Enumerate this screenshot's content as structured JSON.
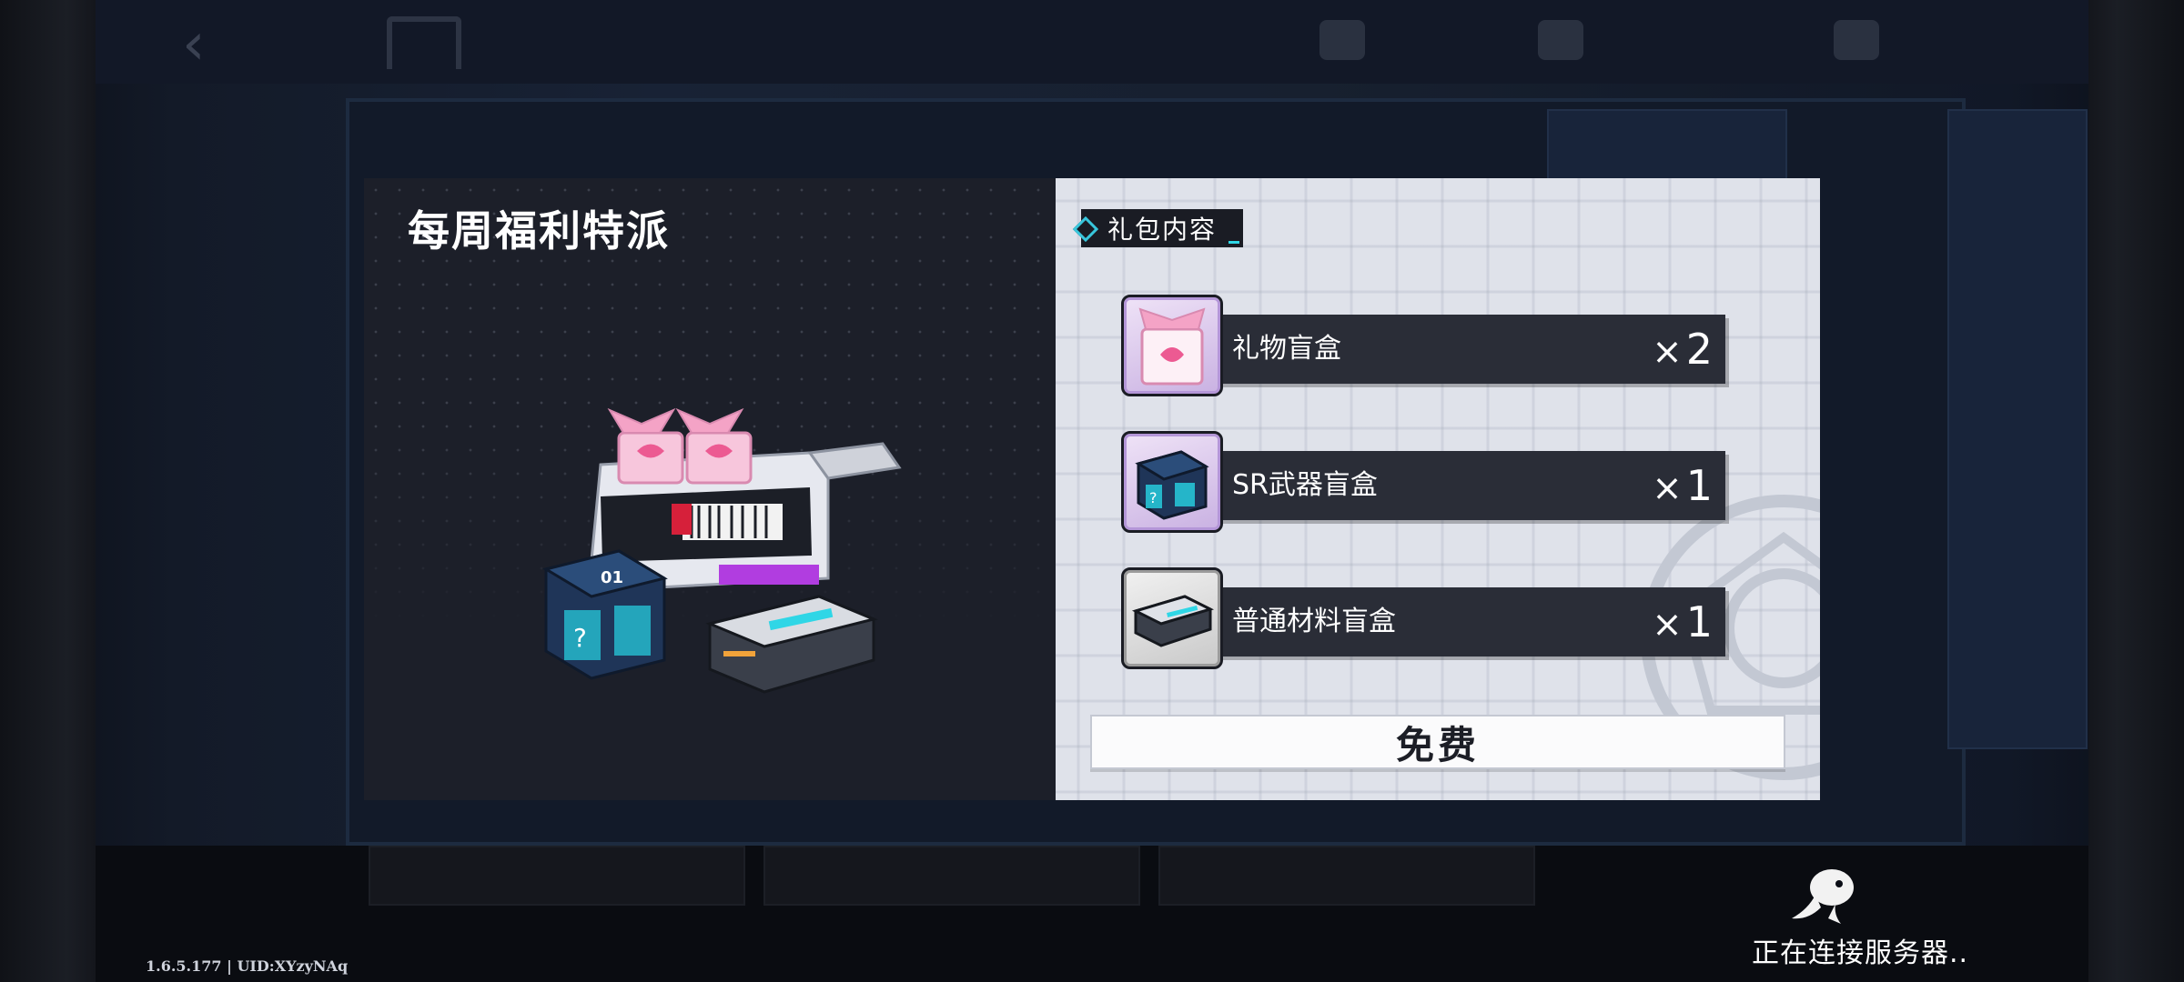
{
  "dialog": {
    "title": "每周福利特派",
    "section_label": "礼包内容",
    "items": [
      {
        "name": "礼物盲盒",
        "qty_prefix": "×",
        "qty": "2",
        "icon": "gift-bag-icon"
      },
      {
        "name": "SR武器盲盒",
        "qty_prefix": "×",
        "qty": "1",
        "icon": "weapon-box-icon"
      },
      {
        "name": "普通材料盲盒",
        "qty_prefix": "×",
        "qty": "1",
        "icon": "material-box-icon"
      }
    ],
    "button_label": "免费"
  },
  "status": {
    "version": "1.6.5.177 | UID:XYzyNAq",
    "connecting": "正在连接服务器.."
  },
  "colors": {
    "left_panel": "#1c1f29",
    "right_panel": "#dfe2ea",
    "item_bar": "#2a2d37",
    "accent_cyan": "#38c6dc"
  }
}
